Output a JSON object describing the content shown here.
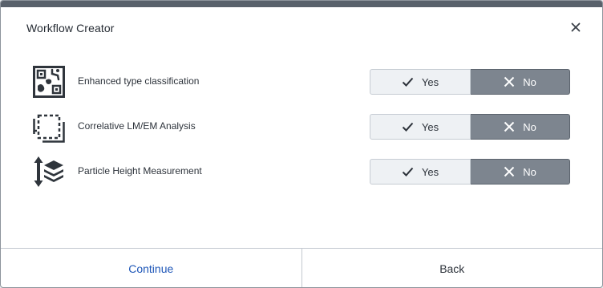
{
  "dialog": {
    "title": "Workflow Creator",
    "close_icon": "close-icon"
  },
  "rows": [
    {
      "icon": "classification-icon",
      "label": "Enhanced type classification",
      "yes_label": "Yes",
      "no_label": "No",
      "selected": "No"
    },
    {
      "icon": "correlative-icon",
      "label": "Correlative LM/EM Analysis",
      "yes_label": "Yes",
      "no_label": "No",
      "selected": "No"
    },
    {
      "icon": "height-measurement-icon",
      "label": "Particle Height Measurement",
      "yes_label": "Yes",
      "no_label": "No",
      "selected": "No"
    }
  ],
  "footer": {
    "continue_label": "Continue",
    "back_label": "Back"
  },
  "colors": {
    "accent": "#1f57b8",
    "selected_segment": "#7d858f",
    "unselected_segment": "#eef1f4",
    "top_bar": "#59616b"
  }
}
